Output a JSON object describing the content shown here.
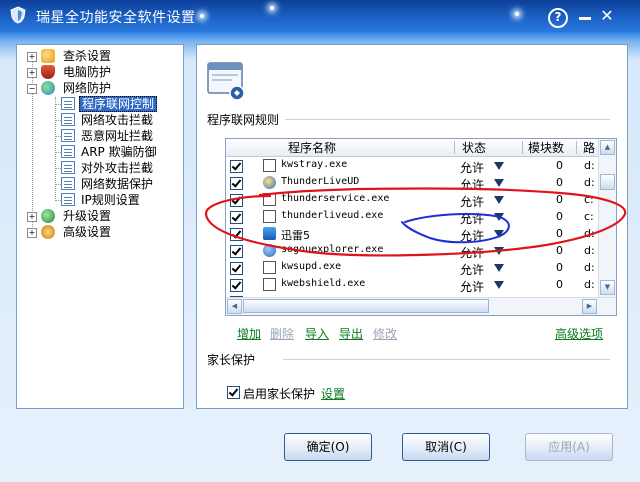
{
  "window": {
    "title": "瑞星全功能安全软件设置",
    "help_label": "?",
    "close_label": "✕"
  },
  "tree": {
    "items": [
      {
        "label": "查杀设置",
        "expander": "+",
        "icon": "scan-icon"
      },
      {
        "label": "电脑防护",
        "expander": "+",
        "icon": "shield-icon"
      },
      {
        "label": "网络防护",
        "expander": "−",
        "icon": "network-icon"
      },
      {
        "label": "升级设置",
        "expander": "+",
        "icon": "upgrade-icon"
      },
      {
        "label": "高级设置",
        "expander": "+",
        "icon": "gear-icon"
      }
    ],
    "network_children": [
      {
        "label": "程序联网控制",
        "selected": true
      },
      {
        "label": "网络攻击拦截"
      },
      {
        "label": "恶意网址拦截"
      },
      {
        "label": "ARP 欺骗防御"
      },
      {
        "label": "对外攻击拦截"
      },
      {
        "label": "网络数据保护"
      },
      {
        "label": "IP规则设置"
      }
    ]
  },
  "rules": {
    "section_title": "程序联网规则",
    "columns": [
      "程序名称",
      "状态",
      "模块数",
      "路"
    ],
    "rows": [
      {
        "name": "kwstray.exe",
        "status": "允许",
        "modules": "0",
        "path": "d:",
        "icon": "app-icon-window"
      },
      {
        "name": "ThunderLiveUD",
        "status": "允许",
        "modules": "0",
        "path": "d:",
        "icon": "globe-icon"
      },
      {
        "name": "thunderservice.exe",
        "status": "允许",
        "modules": "0",
        "path": "c:",
        "icon": "app-icon-window"
      },
      {
        "name": "thunderliveud.exe",
        "status": "允许",
        "modules": "0",
        "path": "c:",
        "icon": "app-icon-window"
      },
      {
        "name": "迅雷5",
        "status": "允许",
        "modules": "0",
        "path": "d:",
        "icon": "xunlei-icon"
      },
      {
        "name": "sogouexplorer.exe",
        "status": "允许",
        "modules": "0",
        "path": "d:",
        "icon": "sogou-icon"
      },
      {
        "name": "kwsupd.exe",
        "status": "允许",
        "modules": "0",
        "path": "d:",
        "icon": "app-icon-window"
      },
      {
        "name": "kwebshield.exe",
        "status": "允许",
        "modules": "0",
        "path": "d:",
        "icon": "app-icon-window"
      }
    ],
    "actions": {
      "add": "增加",
      "delete": "删除",
      "import": "导入",
      "export": "导出",
      "edit": "修改",
      "advanced": "高级选项"
    }
  },
  "parental": {
    "section_title": "家长保护",
    "enable_label": "启用家长保护",
    "settings_link": "设置"
  },
  "buttons": {
    "ok": "确定(O)",
    "cancel": "取消(C)",
    "apply": "应用(A)"
  },
  "colors": {
    "link_enabled": "#0a7a1f",
    "link_disabled": "#9aa6b5",
    "annotation_red": "#e0121b",
    "annotation_blue": "#1a2fd6",
    "titlebar": "#1d64c8"
  }
}
